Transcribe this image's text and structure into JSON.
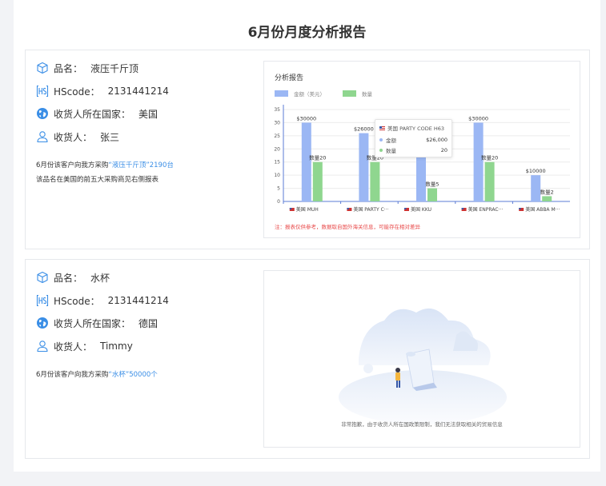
{
  "page": {
    "title": "6月份月度分析报告"
  },
  "labels": {
    "product": "品名：",
    "hscode": "HScode：",
    "country": "收货人所在国家：",
    "consignee": "收货人："
  },
  "records": [
    {
      "product": "液压千斤顶",
      "hscode": "2131441214",
      "country": "美国",
      "consignee": "张三",
      "summary_prefix": "6月份该客户向我方采购",
      "summary_item": "“液压千斤顶”2190台",
      "summary_line2": "该品名在美国的前五大采购商见右侧报表"
    },
    {
      "product": "水杯",
      "hscode": "2131441214",
      "country": "德国",
      "consignee": "Timmy",
      "summary_prefix": "6月份该客户向我方采购",
      "summary_item": "“水杯”50000个",
      "empty_message": "非常抱歉，由于收货人所在国政策限制，我们无法获取相关的贸易信息"
    }
  ],
  "chart_data": {
    "type": "bar",
    "title": "分析报告",
    "categories": [
      "美国 MUH",
      "美国 PARTY C···",
      "美国 KKU",
      "美国 ENPRAC···",
      "美国 ABBA M···"
    ],
    "series": [
      {
        "name": "金额（美元）",
        "values": [
          30,
          26,
          17,
          30,
          10
        ],
        "labels": [
          "$30000",
          "$26000",
          "",
          "$30000",
          "$10000"
        ]
      },
      {
        "name": "数量",
        "values": [
          15,
          15,
          5,
          15,
          2
        ],
        "labels": [
          "数量20",
          "数量20",
          "数量5",
          "数量20",
          "数量2"
        ]
      }
    ],
    "y_ticks": [
      "0",
      "5",
      "10",
      "15",
      "20",
      "25",
      "30",
      "35"
    ],
    "ylim": [
      0,
      35
    ],
    "grid": true,
    "legend": "top-left",
    "colors": {
      "amount": "#9bb7f4",
      "quantity": "#8fd68f"
    },
    "tooltip": {
      "header": "美国 PARTY CODE H63",
      "rows": [
        {
          "name": "金额",
          "value": "$26,000"
        },
        {
          "name": "数量",
          "value": "20"
        }
      ]
    },
    "disclaimer": "注：报表仅供参考，数据取自国外海关信息，可能存在相对差异"
  }
}
